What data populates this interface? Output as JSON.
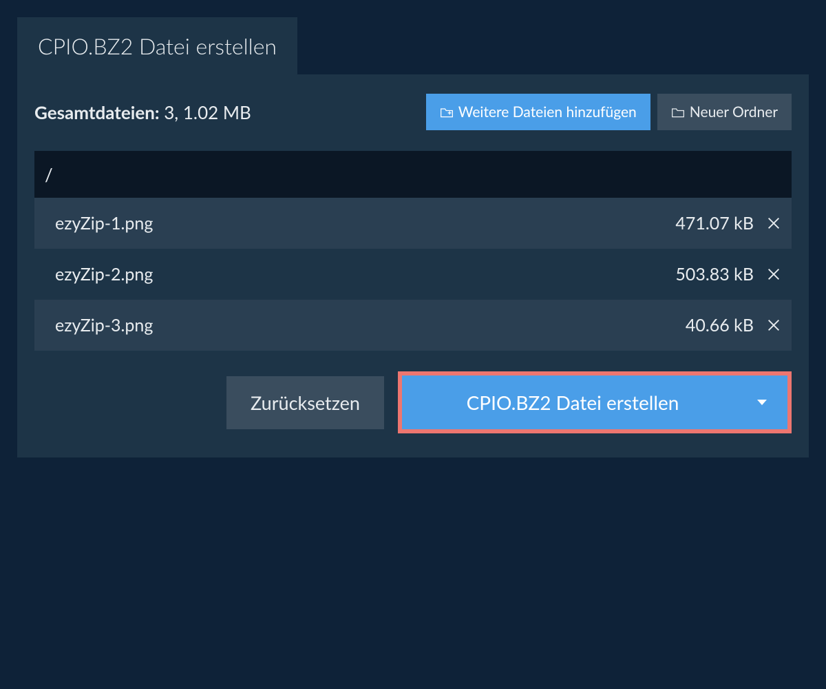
{
  "tab": {
    "title": "CPIO.BZ2 Datei erstellen"
  },
  "summary": {
    "label": "Gesamtdateien:",
    "value": "3, 1.02 MB"
  },
  "toolbar": {
    "add_files_label": "Weitere Dateien hinzufügen",
    "new_folder_label": "Neuer Ordner"
  },
  "path": "/",
  "files": [
    {
      "name": "ezyZip-1.png",
      "size": "471.07 kB"
    },
    {
      "name": "ezyZip-2.png",
      "size": "503.83 kB"
    },
    {
      "name": "ezyZip-3.png",
      "size": "40.66 kB"
    }
  ],
  "actions": {
    "reset_label": "Zurücksetzen",
    "create_label": "CPIO.BZ2 Datei erstellen"
  }
}
